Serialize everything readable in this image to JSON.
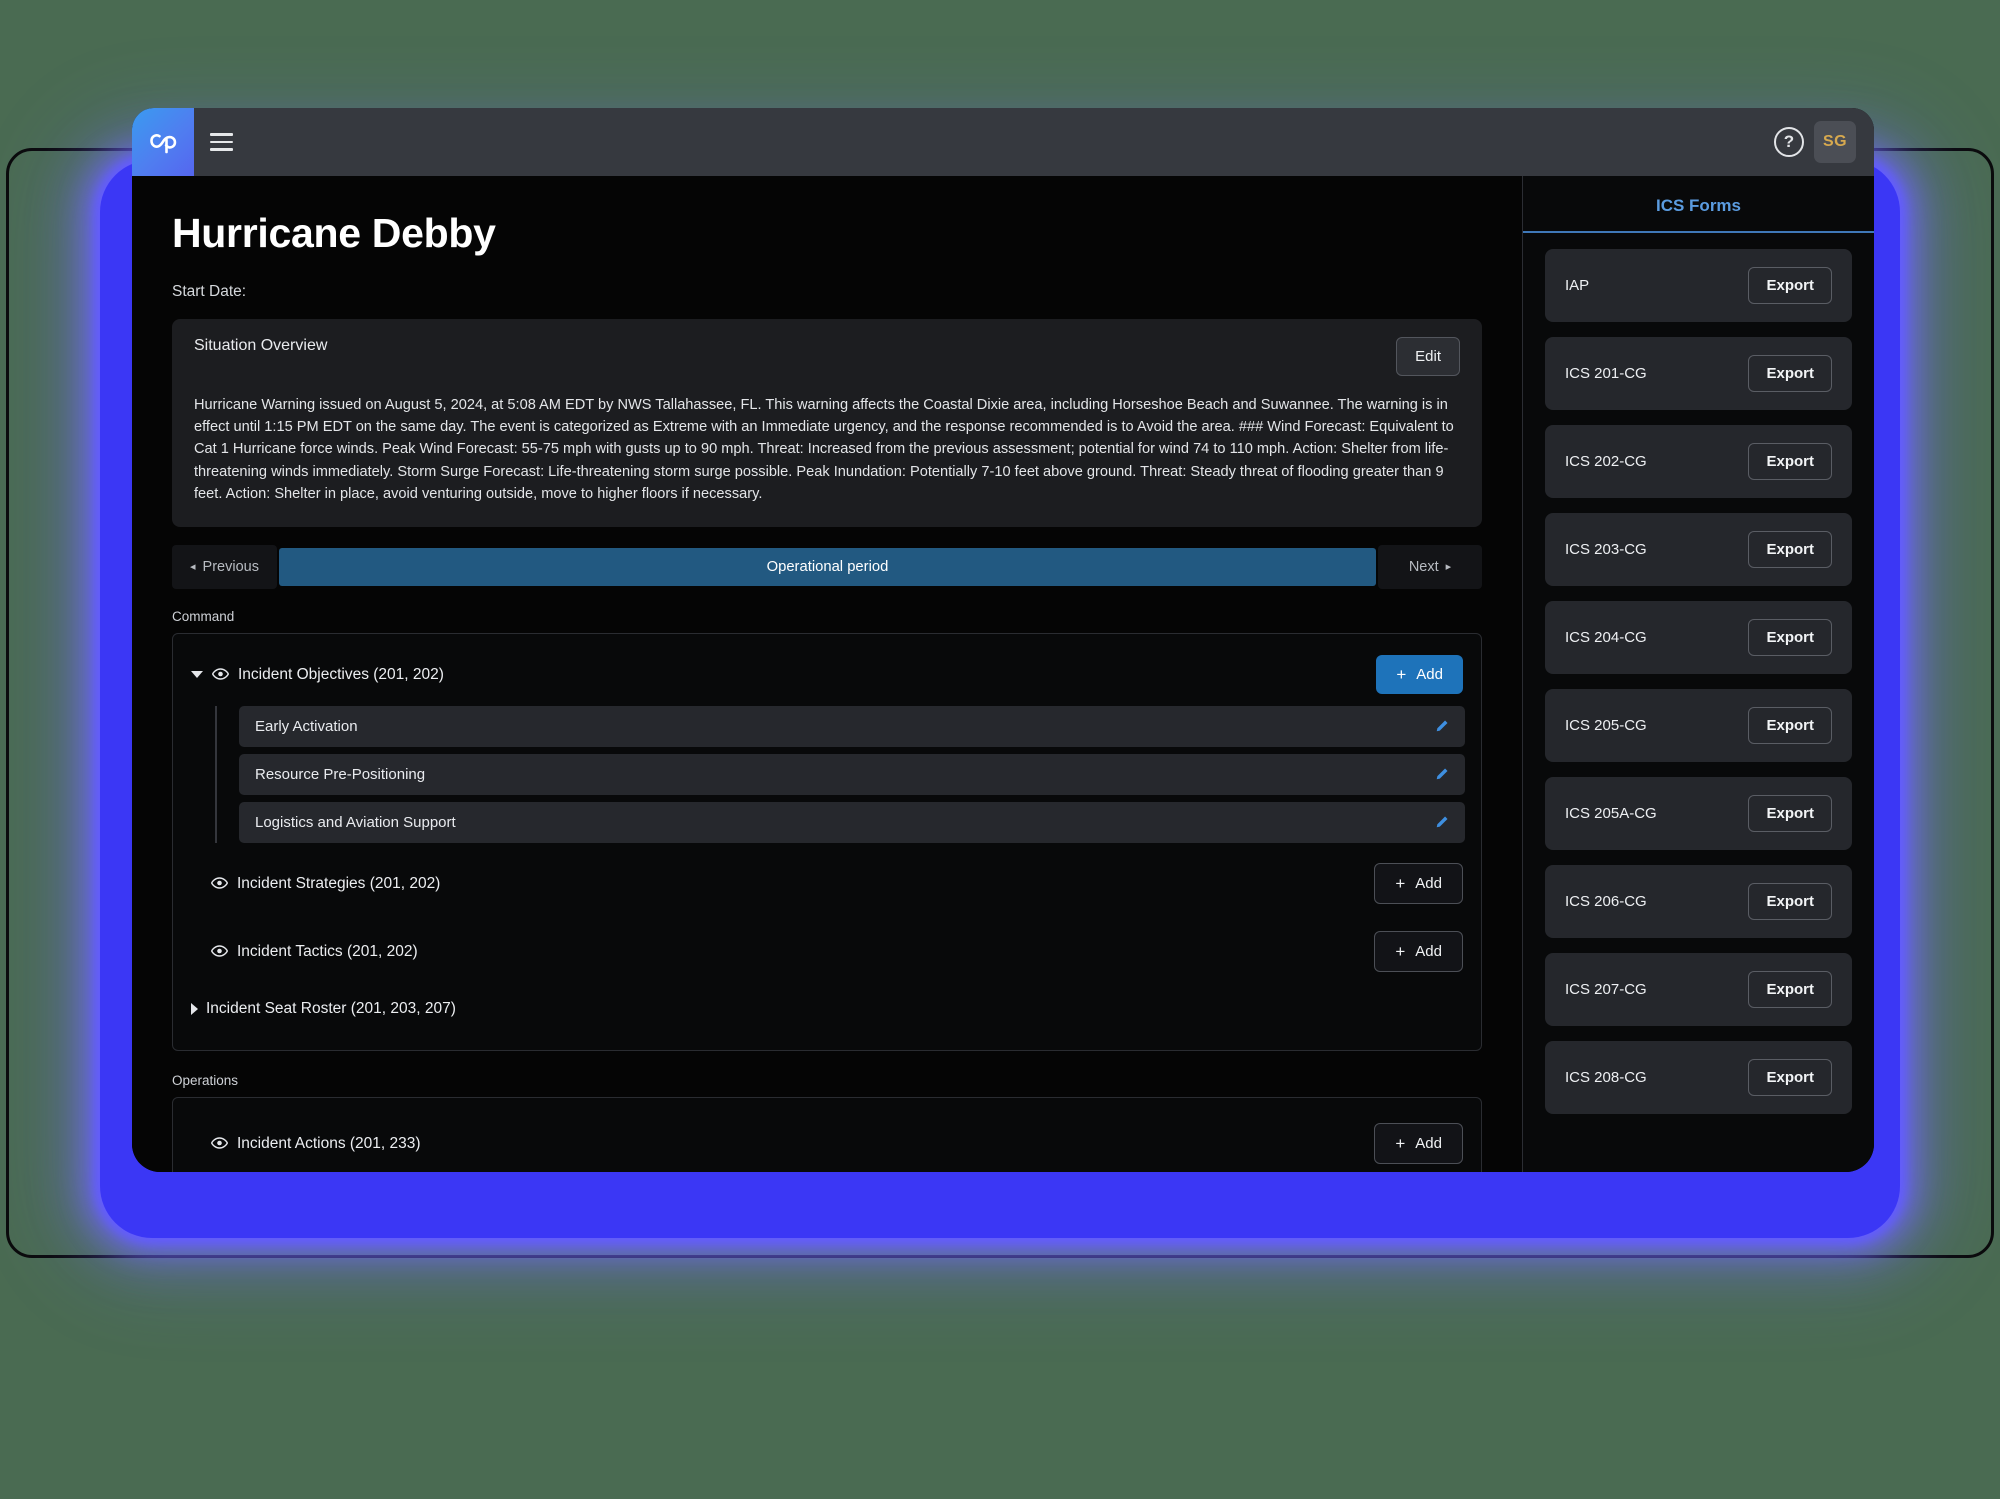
{
  "topbar": {
    "logo_icon": "cp-logo-icon",
    "menu_icon": "hamburger-menu-icon",
    "help_icon": "help-circle-icon",
    "help_glyph": "?",
    "avatar_initials": "SG"
  },
  "page": {
    "title": "Hurricane Debby",
    "start_date_label": "Start Date:"
  },
  "situation": {
    "title": "Situation Overview",
    "edit_label": "Edit",
    "body": "Hurricane Warning issued on August 5, 2024, at 5:08 AM EDT by NWS Tallahassee, FL. This warning affects the Coastal Dixie area, including Horseshoe Beach and Suwannee. The warning is in effect until 1:15 PM EDT on the same day. The event is categorized as Extreme with an Immediate urgency, and the response recommended is to Avoid the area. ### Wind Forecast: Equivalent to Cat 1 Hurricane force winds. Peak Wind Forecast: 55-75 mph with gusts up to 90 mph. Threat: Increased from the previous assessment; potential for wind 74 to 110 mph. Action: Shelter from life-threatening winds immediately. Storm Surge Forecast: Life-threatening storm surge possible. Peak Inundation: Potentially 7-10 feet above ground. Threat: Steady threat of flooding greater than 9 feet. Action: Shelter in place, avoid venturing outside, move to higher floors if necessary."
  },
  "operational_period": {
    "previous_label": "Previous",
    "previous_caret": "◂",
    "center_label": "Operational period",
    "next_label": "Next",
    "next_caret": "▸"
  },
  "command": {
    "group_label": "Command",
    "objectives": {
      "label": "Incident Objectives (201, 202)",
      "add_label": "Add",
      "add_plus": "+",
      "items": [
        {
          "label": "Early Activation"
        },
        {
          "label": "Resource Pre-Positioning"
        },
        {
          "label": "Logistics and Aviation Support"
        }
      ]
    },
    "strategies": {
      "label": "Incident Strategies (201, 202)",
      "add_label": "Add",
      "add_plus": "+"
    },
    "tactics": {
      "label": "Incident Tactics (201, 202)",
      "add_label": "Add",
      "add_plus": "+"
    },
    "seat_roster": {
      "label": "Incident Seat Roster (201, 203, 207)"
    }
  },
  "operations": {
    "group_label": "Operations",
    "actions": {
      "label": "Incident Actions (201, 233)",
      "add_label": "Add",
      "add_plus": "+"
    }
  },
  "forms_panel": {
    "title": "ICS Forms",
    "export_label": "Export",
    "items": [
      {
        "name": "IAP"
      },
      {
        "name": "ICS 201-CG"
      },
      {
        "name": "ICS 202-CG"
      },
      {
        "name": "ICS 203-CG"
      },
      {
        "name": "ICS 204-CG"
      },
      {
        "name": "ICS 205-CG"
      },
      {
        "name": "ICS 205A-CG"
      },
      {
        "name": "ICS 206-CG"
      },
      {
        "name": "ICS 207-CG"
      },
      {
        "name": "ICS 208-CG"
      }
    ]
  },
  "colors": {
    "accent_blue": "#1e73ba",
    "forms_title_blue": "#5b9ce0",
    "op_period_blue": "#225981",
    "glow_blue": "#3b37f5",
    "avatar_gold": "#d7a94f",
    "page_bg_green": "#4a6b52"
  }
}
